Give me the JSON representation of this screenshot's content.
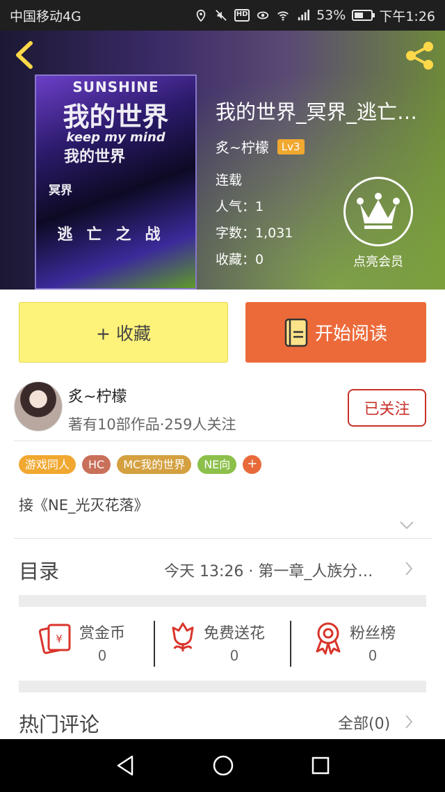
{
  "status_bar": {
    "carrier": "中国移动4G",
    "battery": "53%",
    "battery_level": 0.53,
    "time": "下午1:26",
    "icons": [
      "location-icon",
      "mute-icon",
      "hd-icon",
      "eye-icon",
      "wifi-icon",
      "signal-icon",
      "battery-icon"
    ]
  },
  "header": {
    "cover_lines": [
      "SUNSHINE",
      "我的世界",
      "keep my mind",
      "我的世界",
      "冥界",
      "逃亡之战"
    ],
    "book_title": "我的世界_冥界_逃亡…",
    "author": "炙~柠檬",
    "level": "Lv3",
    "status": "连载",
    "popularity": "人气：1",
    "word_count": "字数：1,031",
    "favorites": "收藏：0",
    "vip_label": "点亮会员"
  },
  "actions": {
    "collect": "+ 收藏",
    "read": "开始阅读"
  },
  "author_card": {
    "name": "炙~柠檬",
    "stats": "著有10部作品·259人关注",
    "follow": "已关注"
  },
  "tags": [
    {
      "label": "游戏同人",
      "color": "#f0a830"
    },
    {
      "label": "HC",
      "color": "#c8705a"
    },
    {
      "label": "MC我的世界",
      "color": "#d4a040"
    },
    {
      "label": "NE向",
      "color": "#8cc04a"
    }
  ],
  "tag_add": "+",
  "description": "接《NE_光灭花落》",
  "toc": {
    "title": "目录",
    "latest": "今天 13:26 · 第一章_人族分…"
  },
  "rewards": [
    {
      "label": "赏金币",
      "value": "0",
      "icon": "red-envelope-icon"
    },
    {
      "label": "免费送花",
      "value": "0",
      "icon": "flower-icon"
    },
    {
      "label": "粉丝榜",
      "value": "0",
      "icon": "medal-icon"
    }
  ],
  "comments": {
    "title": "热门评论",
    "all": "全部(0)"
  },
  "colors": {
    "accent_orange": "#ec6a3a",
    "collect_yellow": "#fdf27a",
    "follow_red": "#c8302a",
    "icon_red": "#d9342b"
  }
}
